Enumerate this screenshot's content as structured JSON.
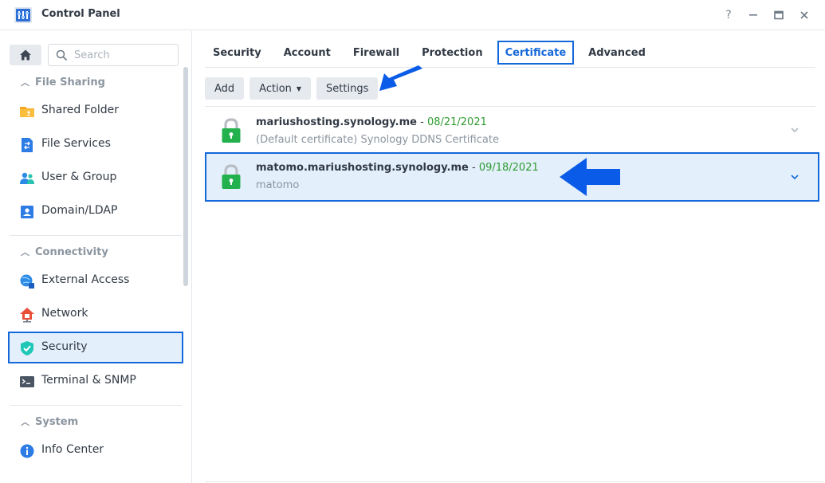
{
  "window": {
    "title": "Control Panel",
    "controls": {
      "help": "?",
      "minimize": "—",
      "maximize": "□",
      "close": "✕"
    }
  },
  "sidebar": {
    "search_placeholder": "Search",
    "sections": [
      {
        "label": "File Sharing",
        "items": [
          "Shared Folder",
          "File Services",
          "User & Group",
          "Domain/LDAP"
        ]
      },
      {
        "label": "Connectivity",
        "items": [
          "External Access",
          "Network",
          "Security",
          "Terminal & SNMP"
        ]
      },
      {
        "label": "System",
        "items": [
          "Info Center"
        ]
      }
    ],
    "active_item": "Security"
  },
  "tabs": [
    "Security",
    "Account",
    "Firewall",
    "Protection",
    "Certificate",
    "Advanced"
  ],
  "active_tab": "Certificate",
  "toolbar": {
    "add": "Add",
    "action": "Action",
    "settings": "Settings"
  },
  "certificates": [
    {
      "name": "mariushosting.synology.me",
      "separator": "-",
      "date": "08/21/2021",
      "description": "(Default certificate) Synology DDNS Certificate"
    },
    {
      "name": "matomo.mariushosting.synology.me",
      "separator": "-",
      "date": "09/18/2021",
      "description": "matomo"
    }
  ],
  "colors": {
    "accent": "#1468d9",
    "date_green": "#2e9b2e",
    "lock_green": "#22b14c",
    "arrow_blue": "#0a5ce8"
  },
  "icons": [
    "control-panel-icon",
    "home-icon",
    "search-icon",
    "folder-icon",
    "file-services-icon",
    "user-group-icon",
    "domain-icon",
    "external-access-icon",
    "network-icon",
    "shield-icon",
    "terminal-icon",
    "info-icon",
    "lock-icon",
    "chevron-down-icon",
    "arrow-icon"
  ]
}
